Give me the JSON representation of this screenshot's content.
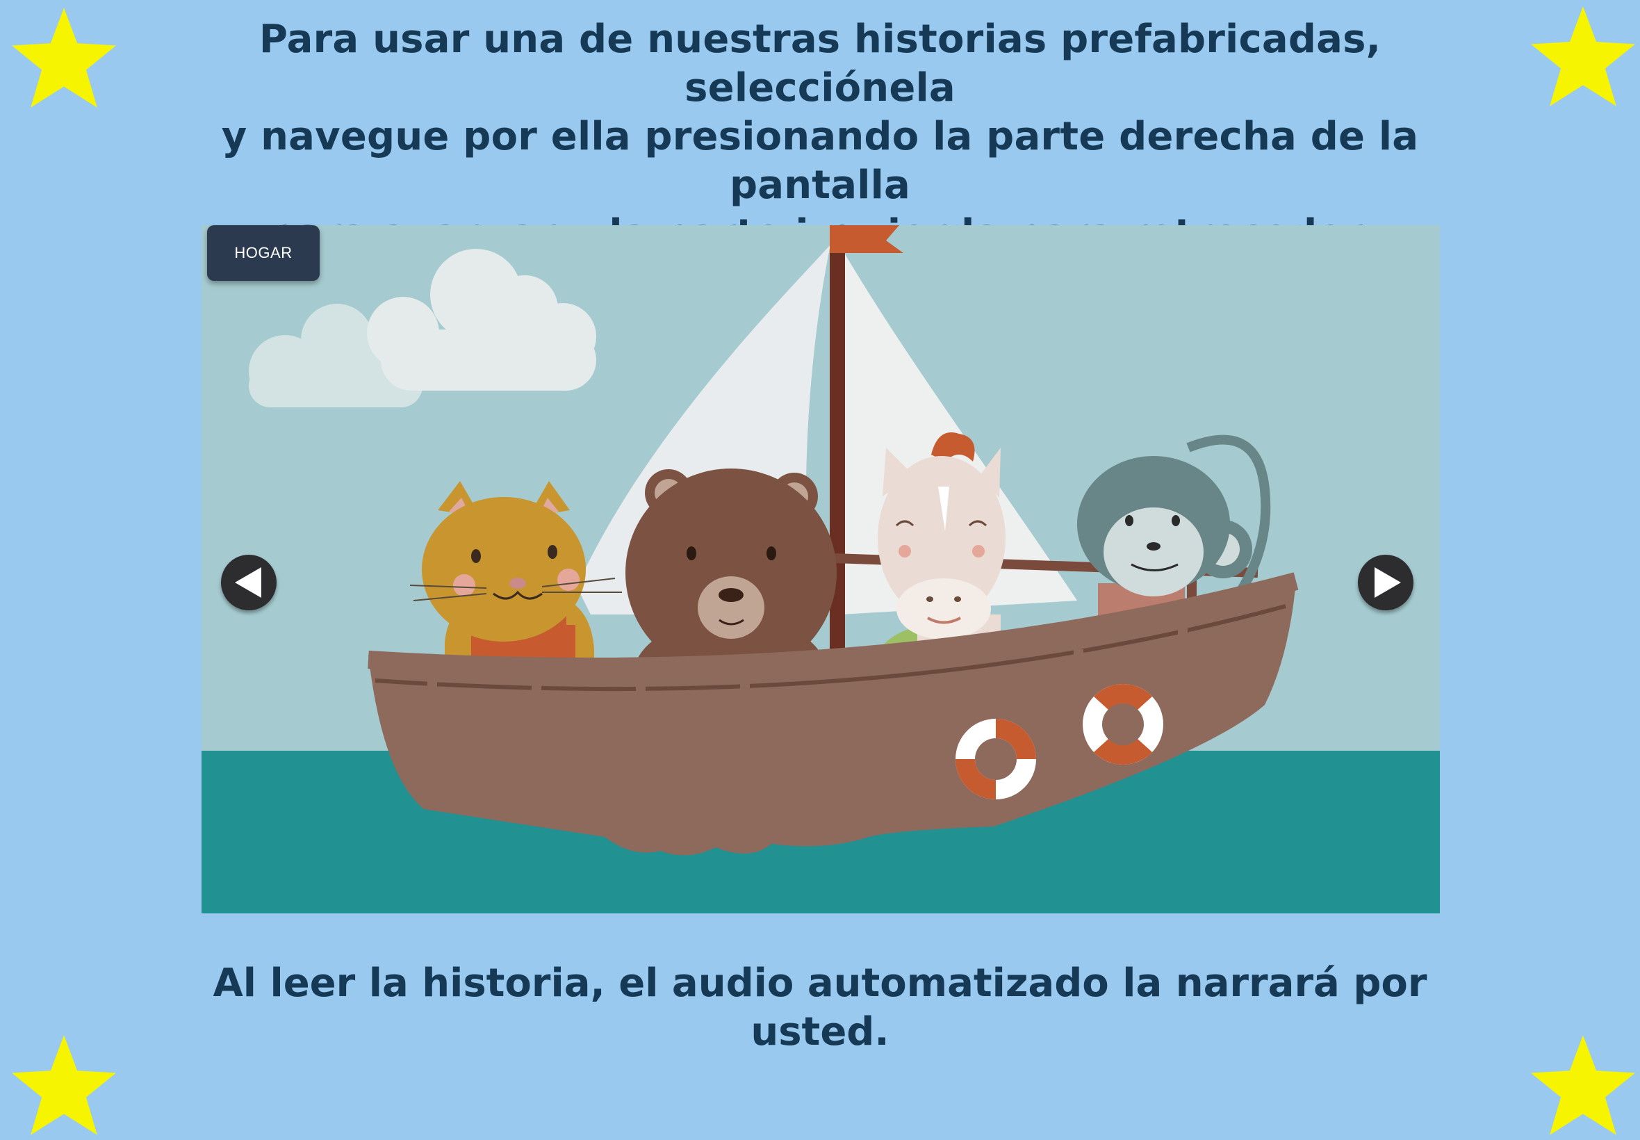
{
  "instructions": {
    "line1": "Para usar una de nuestras historias prefabricadas, selecciónela",
    "line2": "y navegue por ella presionando la parte derecha de la pantalla",
    "line3": "para avanzar y la parte izquierda para retroceder."
  },
  "home_button": {
    "label": "HOGAR"
  },
  "footer": {
    "text": "Al leer la historia, el audio automatizado la narrará por usted."
  },
  "icons": {
    "prev": "left-triangle-arrow-icon",
    "next": "right-triangle-arrow-icon",
    "decoration": "star-icon"
  },
  "colors": {
    "background": "#99c9ef",
    "text": "#163a56",
    "star": "#f7f400",
    "home_button": "#2b3a4f",
    "nav_button": "#2d2d2f",
    "sky": "#a5cbd0",
    "sea": "#229192",
    "boat": "#8e6a5c"
  }
}
